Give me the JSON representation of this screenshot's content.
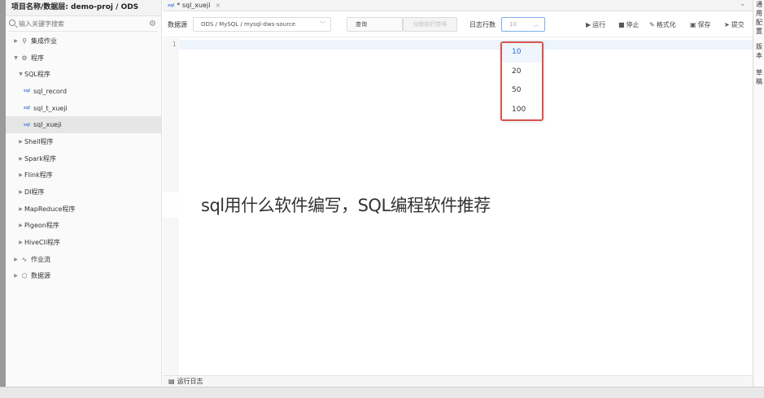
{
  "sidebar": {
    "project_title": "项目名称/数据层:  demo-proj / ODS",
    "search_placeholder": "输入关键字搜索",
    "tree": [
      {
        "label": "集成作业",
        "icon": "integration-icon",
        "expanded": false
      },
      {
        "label": "程序",
        "icon": "gear-icon",
        "expanded": true
      },
      {
        "label": "SQL程序",
        "expanded": true
      },
      {
        "label": "sql_record",
        "icon": "sql-file-icon"
      },
      {
        "label": "sql_t_xueji",
        "icon": "sql-file-icon"
      },
      {
        "label": "sql_xueji",
        "icon": "sql-file-icon",
        "selected": true
      },
      {
        "label": "Shell程序",
        "expanded": false
      },
      {
        "label": "Spark程序",
        "expanded": false
      },
      {
        "label": "Flink程序",
        "expanded": false
      },
      {
        "label": "DI程序",
        "expanded": false
      },
      {
        "label": "MapReduce程序",
        "expanded": false
      },
      {
        "label": "Pigeon程序",
        "expanded": false
      },
      {
        "label": "HiveCli程序",
        "expanded": false
      },
      {
        "label": "作业流",
        "icon": "workflow-icon",
        "expanded": false
      },
      {
        "label": "数据源",
        "icon": "datasource-icon",
        "expanded": false
      }
    ]
  },
  "tab": {
    "badge": "sql",
    "title": "* sql_xueji",
    "close": "×"
  },
  "toolbar": {
    "datasource_label": "数据源",
    "datasource_value": "ODS / MySQL / mysql-dws-source",
    "query_label": "查询",
    "segment_button": "分段执行符号",
    "log_rows_label": "日志行数",
    "log_rows_value": "10",
    "actions": {
      "run": "运行",
      "stop": "停止",
      "format": "格式化",
      "save": "保存",
      "submit": "提交"
    }
  },
  "editor": {
    "line_numbers": [
      "1"
    ]
  },
  "dropdown": {
    "options": [
      "10",
      "20",
      "50",
      "100"
    ],
    "selected": "10",
    "highlight_color": "#d9534f"
  },
  "overlay_caption": "sql用什么软件编写，SQL编程软件推荐",
  "log_bar": {
    "label": "运行日志"
  },
  "right_panel": {
    "groups": [
      [
        "通",
        "用",
        "配",
        "置"
      ],
      [
        "版",
        "本"
      ],
      [
        "草",
        "稿"
      ]
    ]
  },
  "colors": {
    "accent_blue": "#2f6fd0",
    "dropdown_border": "#d9534f",
    "selected_row": "#e6e6e6"
  }
}
